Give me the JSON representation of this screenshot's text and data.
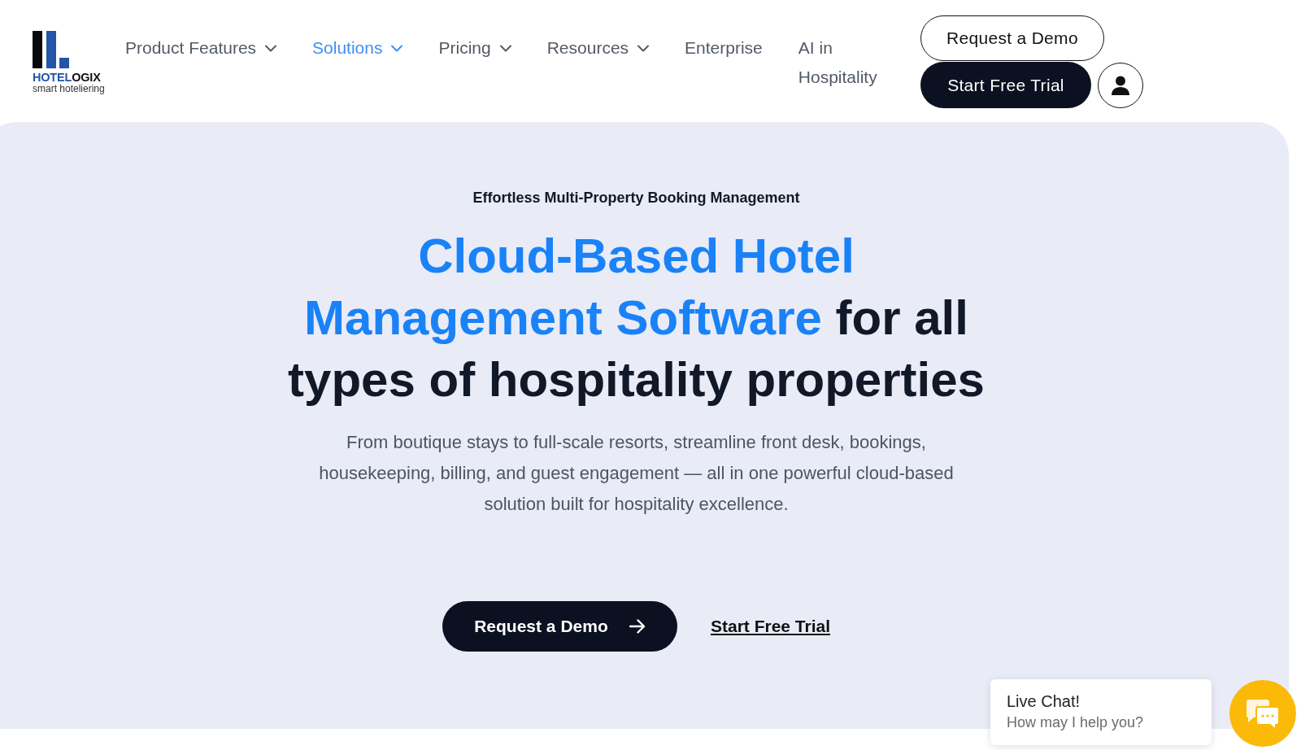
{
  "logo": {
    "name_part_1": "HOTEL",
    "name_part_2": "OGIX",
    "tagline": "smart hoteliering"
  },
  "nav_items": [
    {
      "label": "Product Features",
      "has_dropdown": true,
      "selected": false
    },
    {
      "label": "Solutions",
      "has_dropdown": true,
      "selected": true
    },
    {
      "label": "Pricing",
      "has_dropdown": true,
      "selected": false
    },
    {
      "label": "Resources",
      "has_dropdown": true,
      "selected": false
    },
    {
      "label": "Enterprise",
      "has_dropdown": false,
      "selected": false
    },
    {
      "label": "AI in Hospitality",
      "has_dropdown": false,
      "selected": false
    }
  ],
  "header_buttons": [
    {
      "label": "Request a Demo",
      "kind": "outline"
    },
    {
      "label": "Start Free Trial",
      "kind": "solid"
    }
  ],
  "hero": {
    "eyebrow": "Effortless Multi-Property Booking Management",
    "heading_highlight": "Cloud-Based Hotel Management Software",
    "heading_rest": "for all types of hospitality properties",
    "description": "From boutique stays to full-scale resorts, streamline front desk, bookings, housekeeping, billing, and guest engagement — all in one powerful cloud-based solution built for hospitality excellence.",
    "primary_button": {
      "label": "Request a Demo"
    },
    "secondary_link": {
      "label": "Start Free Trial"
    }
  },
  "live_chat": {
    "title": "Live Chat!",
    "subtitle": "How may I help you?"
  }
}
